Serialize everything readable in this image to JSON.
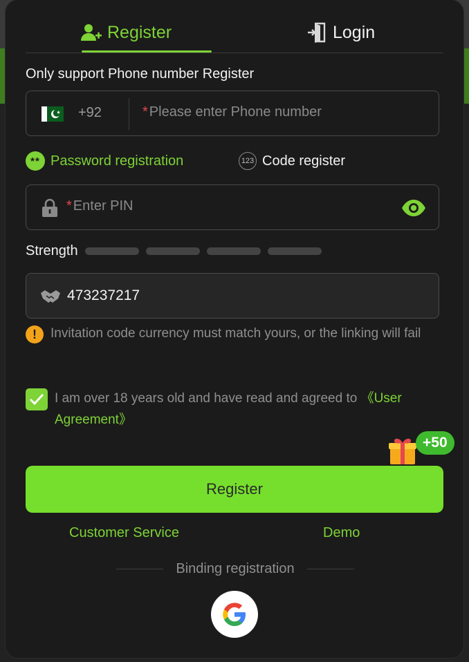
{
  "tabs": {
    "register": "Register",
    "login": "Login"
  },
  "form": {
    "support_label": "Only support Phone number Register",
    "country_code": "+92",
    "phone_star": "*",
    "phone_placeholder": "Please enter Phone number",
    "option_password": "Password registration",
    "option_code": "Code register",
    "option_code_icon_text": "123",
    "pin_star": "*",
    "pin_placeholder": "Enter PIN",
    "strength_label": "Strength",
    "strength_level": 0,
    "invite_code": "473237217",
    "warning_icon_text": "!",
    "warning_text": "Invitation code currency must match yours, or the linking will fail",
    "agree_checked": true,
    "agree_text": "I am over 18 years old and have read and agreed to ",
    "agree_link": "《User Agreement》",
    "bonus": "+50",
    "register_button": "Register"
  },
  "footer": {
    "customer_service": "Customer Service",
    "demo": "Demo",
    "binding": "Binding registration"
  },
  "icons": {
    "register_tab": "add-user-icon",
    "login_tab": "login-door-icon",
    "flag": "pakistan-flag-icon",
    "pin": "lock-icon",
    "visibility": "eye-icon",
    "invite": "handshake-icon",
    "warning": "warning-icon",
    "gift": "gift-icon",
    "google": "google-icon"
  },
  "colors": {
    "accent": "#7ed336",
    "button": "#76df2d",
    "warning": "#f3a31a",
    "error_star": "#e5484d"
  }
}
